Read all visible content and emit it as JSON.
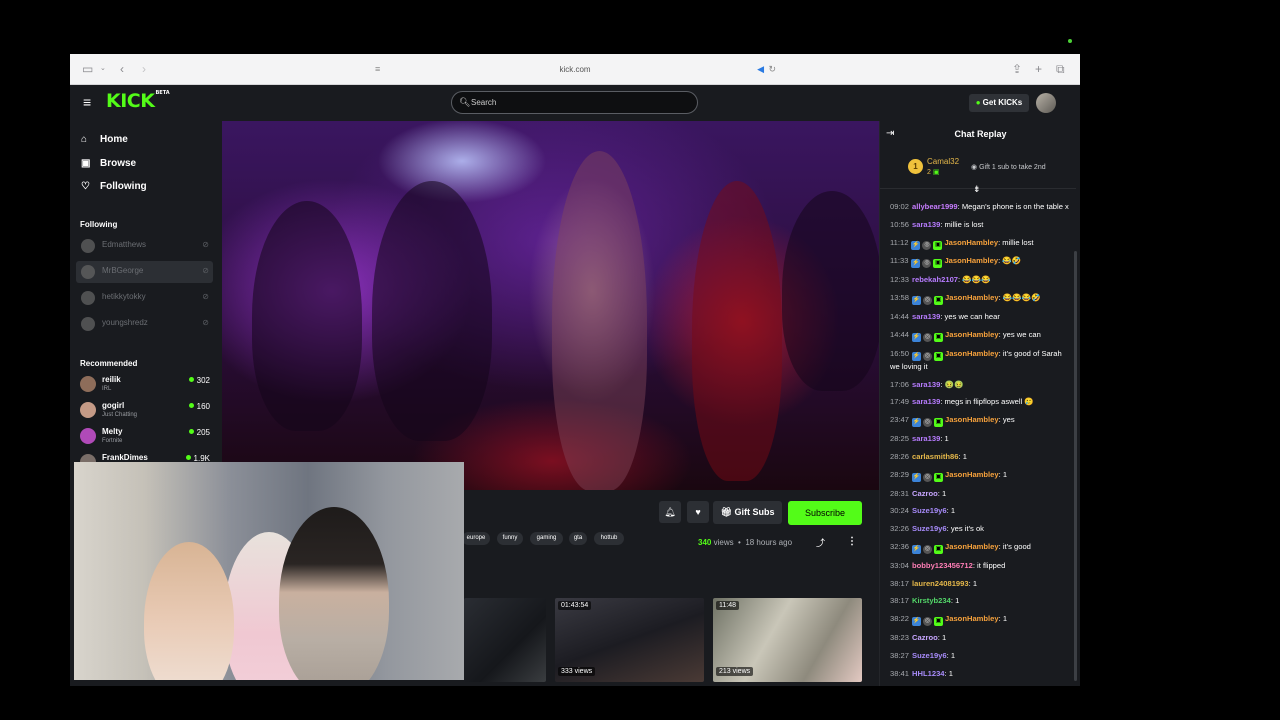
{
  "browser": {
    "url": "kick.com"
  },
  "header": {
    "logo": "KICK",
    "logo_badge": "BETA",
    "search_placeholder": "Search",
    "get_kicks_label": "Get KICKs"
  },
  "sidebar": {
    "nav": [
      {
        "label": "Home",
        "icon": "home-icon"
      },
      {
        "label": "Browse",
        "icon": "browse-icon"
      },
      {
        "label": "Following",
        "icon": "heart-icon"
      }
    ],
    "following_title": "Following",
    "following": [
      {
        "name": "Edmatthews"
      },
      {
        "name": "MrBGeorge"
      },
      {
        "name": "hetikkytokky"
      },
      {
        "name": "youngshredz"
      }
    ],
    "recommended_title": "Recommended",
    "recommended": [
      {
        "name": "reilik",
        "category": "IRL",
        "viewers": "302"
      },
      {
        "name": "gogirl",
        "category": "Just Chatting",
        "viewers": "160"
      },
      {
        "name": "Melty",
        "category": "Fortnite",
        "viewers": "205"
      },
      {
        "name": "FrankDimes",
        "category": "",
        "viewers": "1.9K"
      }
    ]
  },
  "video_actions": {
    "gift_subs_label": "Gift Subs",
    "subscribe_label": "Subscribe",
    "tags": [
      "europe",
      "funny",
      "gaming",
      "gta",
      "hottub"
    ],
    "views_count": "340",
    "views_word": "views",
    "time_ago": "18 hours ago"
  },
  "related_videos": [
    {
      "duration": "",
      "views": ""
    },
    {
      "duration": "01:43:54",
      "views": "333 views"
    },
    {
      "duration": "11:48",
      "views": "213 views"
    }
  ],
  "chat": {
    "title": "Chat Replay",
    "pinned": {
      "rank": "1",
      "user": "Camal32",
      "sub_count": "2",
      "gift_text": "Gift 1 sub to take 2nd"
    },
    "messages": [
      {
        "time": "09:02",
        "user": "allybear1999",
        "color": "#c77dff",
        "badges": [],
        "text": "Megan's phone is on the table x"
      },
      {
        "time": "10:56",
        "user": "sara139",
        "color": "#b77cff",
        "badges": [],
        "text": "millie is lost"
      },
      {
        "time": "11:12",
        "user": "JasonHambley",
        "color": "#f7a23c",
        "badges": [
          "bolt",
          "mod",
          "gift"
        ],
        "text": "millie lost"
      },
      {
        "time": "11:33",
        "user": "JasonHambley",
        "color": "#f7a23c",
        "badges": [
          "bolt",
          "mod",
          "gift"
        ],
        "text": "😂🤣"
      },
      {
        "time": "12:33",
        "user": "rebekah2107",
        "color": "#b77cff",
        "badges": [],
        "text": "😂😂😂"
      },
      {
        "time": "13:58",
        "user": "JasonHambley",
        "color": "#f7a23c",
        "badges": [
          "bolt",
          "mod",
          "gift"
        ],
        "text": "😂😂😂🤣"
      },
      {
        "time": "14:44",
        "user": "sara139",
        "color": "#b77cff",
        "badges": [],
        "text": "yes we can hear"
      },
      {
        "time": "14:44",
        "user": "JasonHambley",
        "color": "#f7a23c",
        "badges": [
          "bolt",
          "mod",
          "gift"
        ],
        "text": "yes we can"
      },
      {
        "time": "16:50",
        "user": "JasonHambley",
        "color": "#f7a23c",
        "badges": [
          "bolt",
          "mod",
          "gift"
        ],
        "text": "it's good of Sarah we loving it"
      },
      {
        "time": "17:06",
        "user": "sara139",
        "color": "#b77cff",
        "badges": [],
        "text": "🤢🤢"
      },
      {
        "time": "17:49",
        "user": "sara139",
        "color": "#b77cff",
        "badges": [],
        "text": "megs in flipflops aswell 🥲"
      },
      {
        "time": "23:47",
        "user": "JasonHambley",
        "color": "#f7a23c",
        "badges": [
          "bolt",
          "mod",
          "gift"
        ],
        "text": "yes"
      },
      {
        "time": "28:25",
        "user": "sara139",
        "color": "#b77cff",
        "badges": [],
        "text": "1"
      },
      {
        "time": "28:26",
        "user": "carlasmith86",
        "color": "#e5b84a",
        "badges": [],
        "text": "1"
      },
      {
        "time": "28:29",
        "user": "JasonHambley",
        "color": "#f7a23c",
        "badges": [
          "bolt",
          "mod",
          "gift"
        ],
        "text": "1"
      },
      {
        "time": "28:31",
        "user": "Cazroo",
        "color": "#c7a6ff",
        "badges": [],
        "text": "1"
      },
      {
        "time": "30:24",
        "user": "Suze19y6",
        "color": "#a78bfa",
        "badges": [],
        "text": "1"
      },
      {
        "time": "32:26",
        "user": "Suze19y6",
        "color": "#a78bfa",
        "badges": [],
        "text": "yes it's ok"
      },
      {
        "time": "32:36",
        "user": "JasonHambley",
        "color": "#f7a23c",
        "badges": [
          "bolt",
          "mod",
          "gift"
        ],
        "text": "it's good"
      },
      {
        "time": "33:04",
        "user": "bobby123456712",
        "color": "#ff7eb6",
        "badges": [],
        "text": "it flipped"
      },
      {
        "time": "38:17",
        "user": "lauren24081993",
        "color": "#e5b84a",
        "badges": [],
        "text": "1"
      },
      {
        "time": "38:17",
        "user": "Kirstyb234",
        "color": "#53d769",
        "badges": [],
        "text": "1"
      },
      {
        "time": "38:22",
        "user": "JasonHambley",
        "color": "#f7a23c",
        "badges": [
          "bolt",
          "mod",
          "gift"
        ],
        "text": "1"
      },
      {
        "time": "38:23",
        "user": "Cazroo",
        "color": "#c7a6ff",
        "badges": [],
        "text": "1"
      },
      {
        "time": "38:27",
        "user": "Suze19y6",
        "color": "#a78bfa",
        "badges": [],
        "text": "1"
      },
      {
        "time": "38:41",
        "user": "HHL1234",
        "color": "#a78bfa",
        "badges": [],
        "text": "1"
      }
    ]
  },
  "colors": {
    "accent": "#53fc18",
    "background": "#191b1f"
  }
}
